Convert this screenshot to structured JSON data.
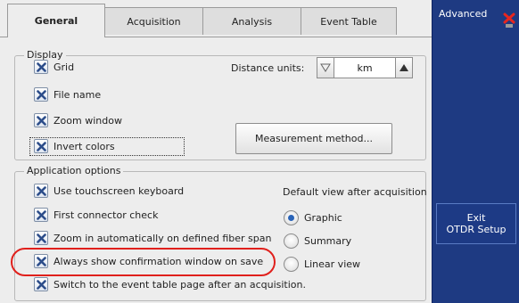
{
  "tabs": [
    "General",
    "Acquisition",
    "Analysis",
    "Event Table"
  ],
  "active_tab": "General",
  "display_group": {
    "title": "Display",
    "checkboxes": [
      {
        "label": "Grid",
        "checked": true
      },
      {
        "label": "File name",
        "checked": true
      },
      {
        "label": "Zoom window",
        "checked": true
      },
      {
        "label": "Invert colors",
        "checked": true
      }
    ],
    "distance_units_label": "Distance units:",
    "distance_units_value": "km",
    "measurement_button": "Measurement method..."
  },
  "app_group": {
    "title": "Application options",
    "checkboxes": [
      {
        "label": "Use touchscreen keyboard",
        "checked": true
      },
      {
        "label": "First connector check",
        "checked": true
      },
      {
        "label": "Zoom in automatically on defined fiber span",
        "checked": true
      },
      {
        "label": "Always show confirmation window on save",
        "checked": true
      },
      {
        "label": "Switch to the event table page after an acquisition.",
        "checked": true
      }
    ],
    "default_view_label": "Default view after acquisition",
    "radio_options": [
      {
        "label": "Graphic",
        "selected": true
      },
      {
        "label": "Summary",
        "selected": false
      },
      {
        "label": "Linear view",
        "selected": false
      }
    ]
  },
  "side_panel": {
    "title": "Advanced",
    "exit_button_line1": "Exit",
    "exit_button_line2": "OTDR Setup"
  },
  "colors": {
    "side_panel": "#1e3a82",
    "highlight": "#e0201c",
    "radio_dot": "#2a64b8"
  }
}
